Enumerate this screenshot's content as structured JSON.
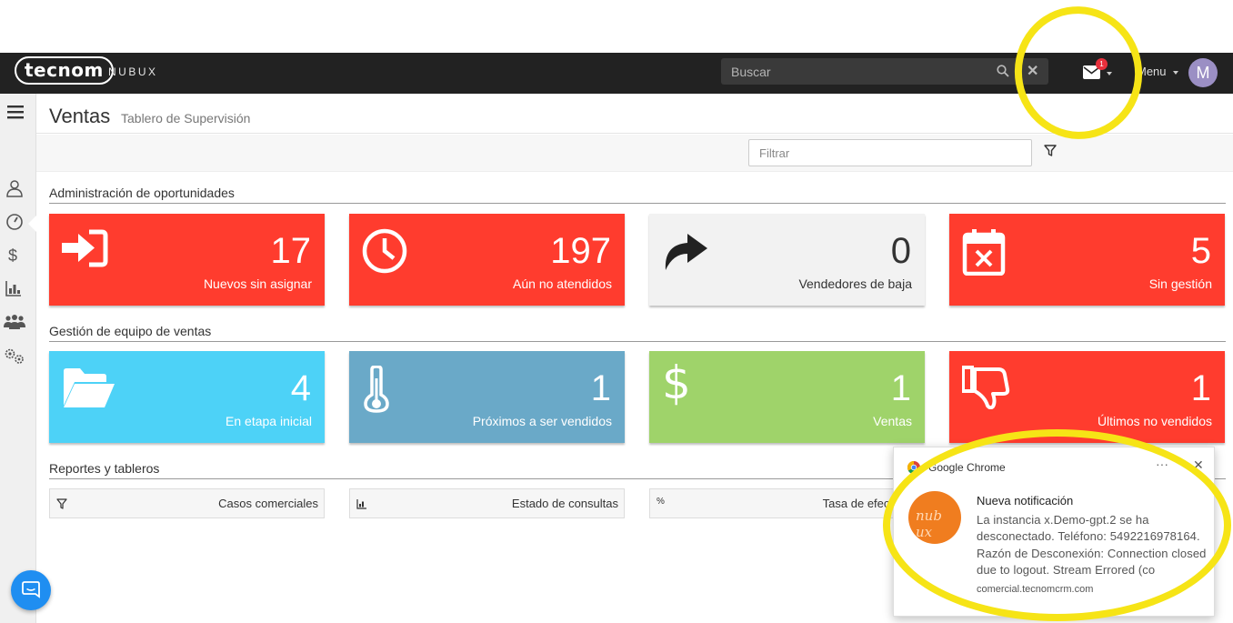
{
  "navbar": {
    "logo": "tecnom",
    "logo_sub": "NUBUX",
    "search_placeholder": "Buscar",
    "search_clear": "✕",
    "mail_badge": "1",
    "menu_label": "Menu",
    "avatar_initial": "M"
  },
  "header": {
    "title": "Ventas",
    "subtitle": "Tablero de Supervisión"
  },
  "filter": {
    "placeholder": "Filtrar"
  },
  "sections": {
    "admin": "Administración de oportunidades",
    "team": "Gestión de equipo de ventas",
    "reports": "Reportes y tableros"
  },
  "cards_admin": [
    {
      "value": "17",
      "label": "Nuevos sin asignar",
      "color": "#ff3c2e",
      "icon": "sign-in-icon"
    },
    {
      "value": "197",
      "label": "Aún no atendidos",
      "color": "#ff3c2e",
      "icon": "clock-icon"
    },
    {
      "value": "0",
      "label": "Vendedores de baja",
      "color": "#f2f2f2",
      "icon": "share-arrow-icon"
    },
    {
      "value": "5",
      "label": "Sin gestión",
      "color": "#ff3c2e",
      "icon": "calendar-x-icon"
    }
  ],
  "cards_team": [
    {
      "value": "4",
      "label": "En etapa inicial",
      "color": "#4dd2f7",
      "icon": "folder-open-icon"
    },
    {
      "value": "1",
      "label": "Próximos a ser vendidos",
      "color": "#6aa9c8",
      "icon": "thermometer-icon"
    },
    {
      "value": "1",
      "label": "Ventas",
      "color": "#9fd36a",
      "icon": "dollar-icon"
    },
    {
      "value": "1",
      "label": "Últimos no vendidos",
      "color": "#ff3c2e",
      "icon": "thumbs-down-icon"
    }
  ],
  "reports": [
    {
      "label": "Casos comerciales",
      "icon": "funnel-icon"
    },
    {
      "label": "Estado de consultas",
      "icon": "bar-chart-icon"
    },
    {
      "label": "Tasa de efect",
      "icon": "percent-icon"
    }
  ],
  "notification": {
    "app": "Google Chrome",
    "more": "···",
    "close": "✕",
    "title": "Nueva notificación",
    "body": "La instancia x.Demo-gpt.2 se ha desconectado. Teléfono: 5492216978164. Razón de Desconexión: Connection closed due to logout. Stream Errored (co",
    "site": "comercial.tecnomcrm.com",
    "logo_text": "nub ux"
  },
  "colors": {
    "navbar": "#222222",
    "red": "#ff3c2e",
    "cyan": "#4dd2f7",
    "steel": "#6aa9c8",
    "green": "#9fd36a",
    "highlight": "#f6e416"
  }
}
